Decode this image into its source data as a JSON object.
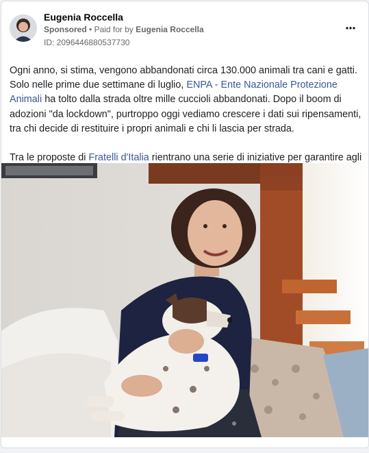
{
  "ad": {
    "advertiser_name": "Eugenia Roccella",
    "sponsored_label": "Sponsored",
    "separator": "•",
    "paid_for_prefix": "Paid for by",
    "paid_for_name": "Eugenia Roccella",
    "id_text": "ID: 2096446880537730",
    "more_icon": "more-horizontal-icon",
    "body": {
      "p1_a": "Ogni anno, si stima, vengono abbandonati circa 130.000 animali tra cani e gatti. Solo nelle prime due settimane di luglio,",
      "p1_link": "ENPA - Ente Nazionale Protezione Animali",
      "p1_b": "ha tolto dalla strada oltre mille cuccioli abbandonati. Dopo il boom di adozioni \"da lockdown\", purtroppo oggi vediamo crescere i dati sui ripensamenti, tra chi decide di restituire i propri animali e chi li lascia per strada.",
      "p2_a": "Tra le proposte di",
      "p2_link": "Fratelli d'Italia",
      "p2_b": "rientrano una serie di iniziative per garantire agli…"
    },
    "colors": {
      "link": "#385898",
      "meta": "#65676b",
      "text": "#1c1e21"
    }
  }
}
